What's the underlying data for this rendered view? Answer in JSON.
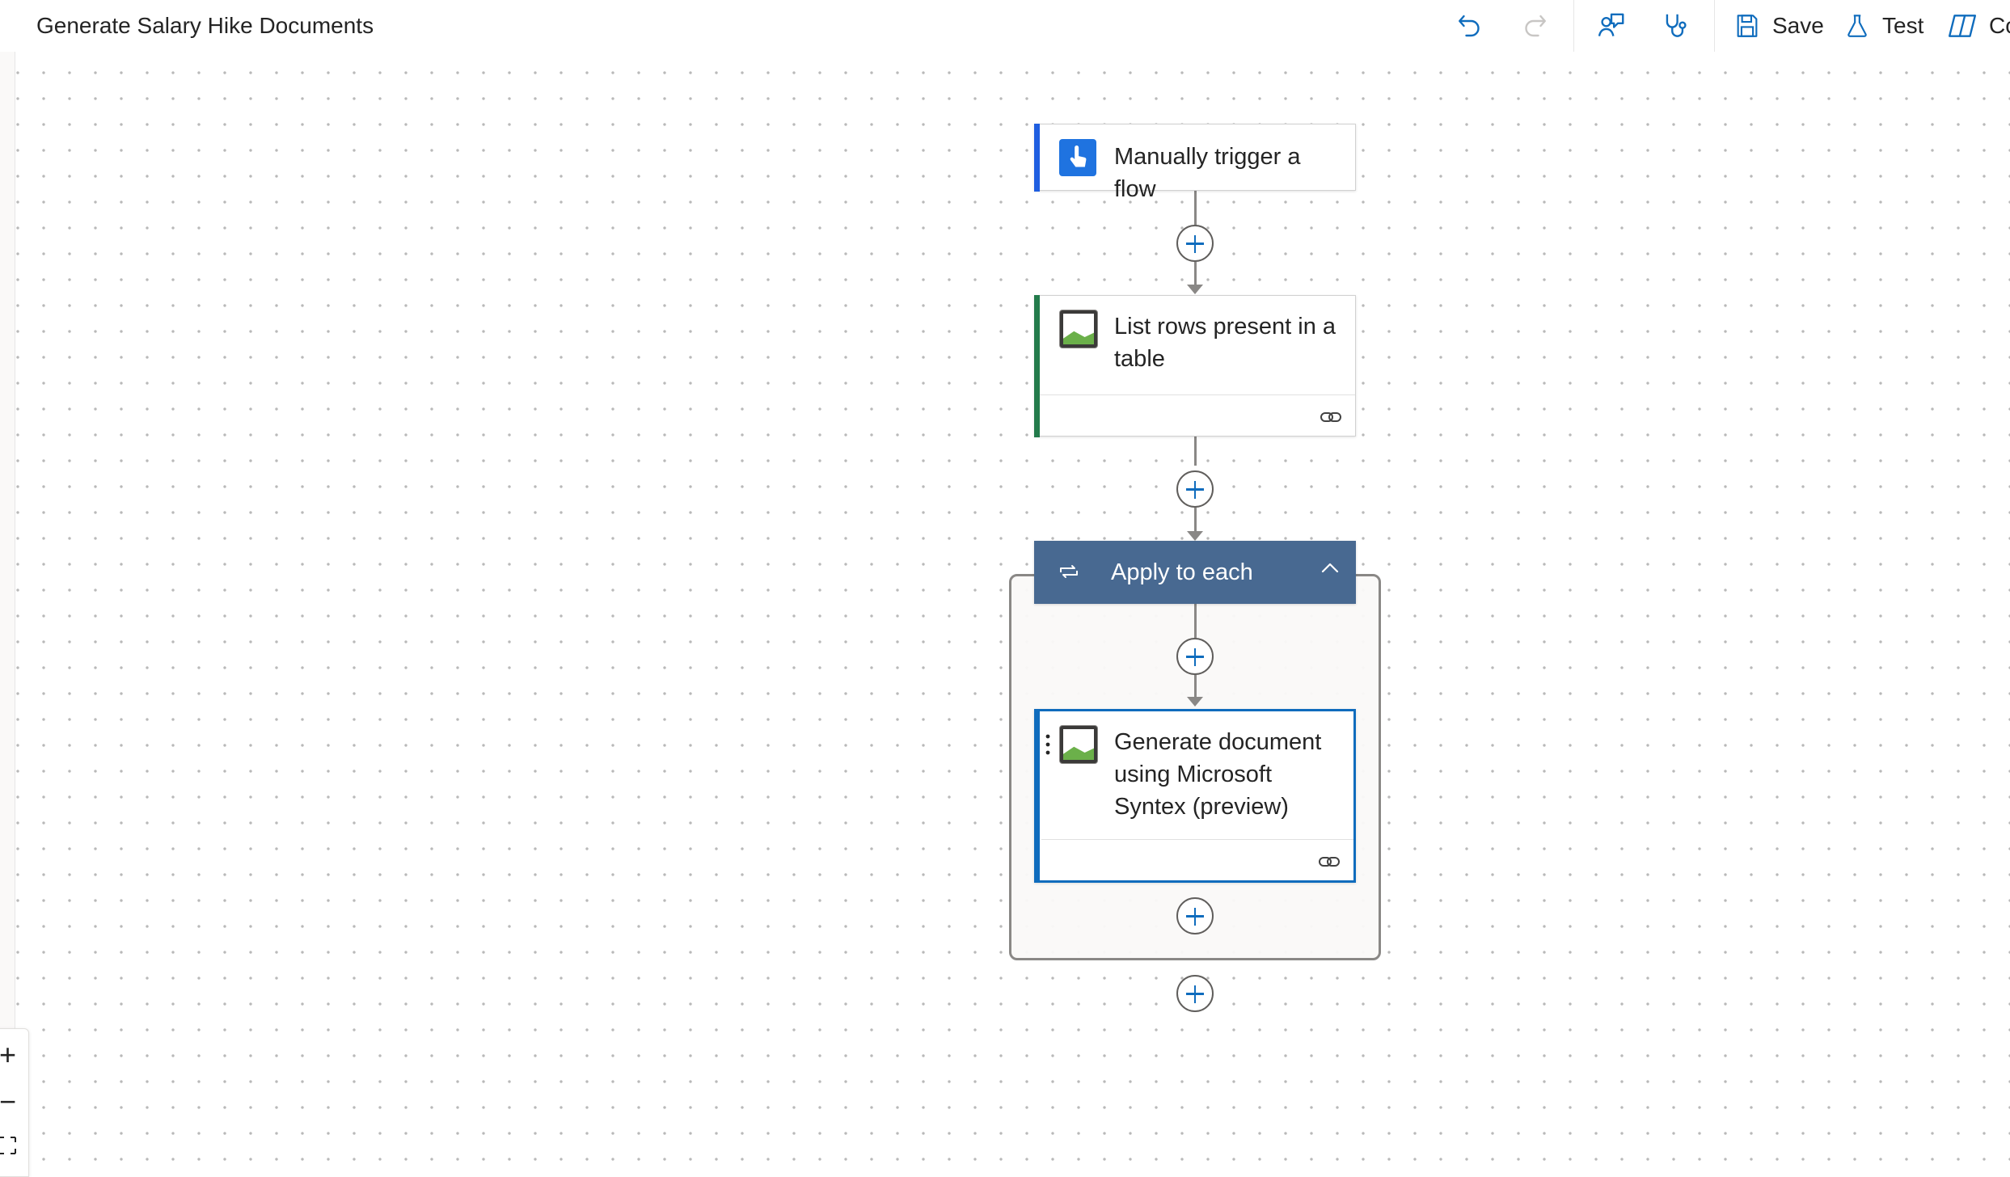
{
  "header": {
    "title": "Generate Salary Hike Documents",
    "save_label": "Save",
    "test_label": "Test",
    "copilot_label_partial": "Co"
  },
  "flow": {
    "trigger": {
      "label": "Manually trigger a flow",
      "icon": "hand-touch-icon",
      "accent": "#1f5ee0"
    },
    "list_rows": {
      "label": "List rows present in a table",
      "icon": "broken-image-icon",
      "accent": "#237b4b"
    },
    "apply_to_each": {
      "label": "Apply to each",
      "icon": "loop-icon",
      "color": "#486991"
    },
    "generate_doc": {
      "label": "Generate document using Microsoft Syntex (preview)",
      "icon": "broken-image-icon",
      "accent": "#0f6cbd"
    }
  },
  "zoom_controls": {
    "zoom_in": "+",
    "zoom_out": "−"
  },
  "colors": {
    "connector": "#8a8886",
    "plus_icon": "#0f6cbd",
    "brand": "#0f6cbd"
  }
}
